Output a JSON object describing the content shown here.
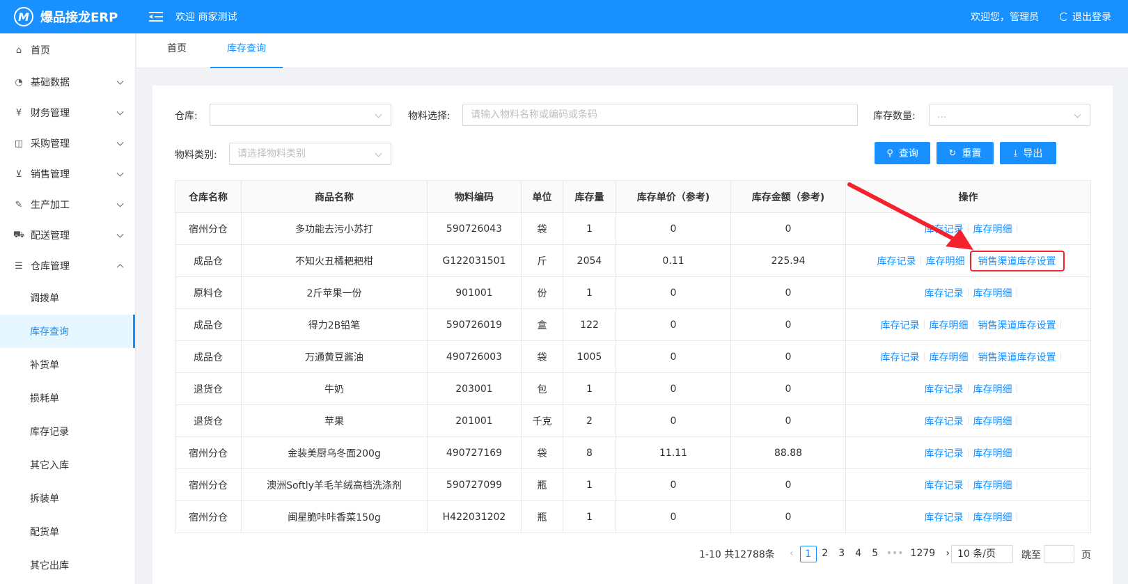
{
  "header": {
    "logo_mark": "M",
    "app_name": "爆品接龙ERP",
    "welcome": "欢迎 商家测试",
    "user": "欢迎您，管理员",
    "logout": "退出登录",
    "bg_color": "#1890ff"
  },
  "sidebar": {
    "items": [
      {
        "label": "首页",
        "icon": "home-icon"
      },
      {
        "label": "基础数据",
        "icon": "pie-chart-icon"
      },
      {
        "label": "财务管理",
        "icon": "finance-icon"
      },
      {
        "label": "采购管理",
        "icon": "bag-icon"
      },
      {
        "label": "销售管理",
        "icon": "cart-icon"
      },
      {
        "label": "生产加工",
        "icon": "wrench-icon"
      },
      {
        "label": "配送管理",
        "icon": "car-icon"
      },
      {
        "label": "仓库管理",
        "icon": "warehouse-icon"
      }
    ],
    "sub_items": [
      "调拨单",
      "库存查询",
      "补货单",
      "损耗单",
      "库存记录",
      "其它入库",
      "拆装单",
      "配货单",
      "其它出库"
    ],
    "active_sub": "库存查询"
  },
  "tabs": [
    "首页",
    "库存查询"
  ],
  "filters": {
    "warehouse_label": "仓库:",
    "material_label": "物料选择:",
    "material_placeholder": "请输入物料名称或编码或条码",
    "qty_label": "库存数量:",
    "qty_placeholder": "...",
    "category_label": "物料类别:",
    "category_placeholder": "请选择物料类别"
  },
  "buttons": {
    "query": "查询",
    "reset": "重置",
    "export": "导出"
  },
  "table": {
    "headers": [
      "仓库名称",
      "商品名称",
      "物料编码",
      "单位",
      "库存量",
      "库存单价（参考)",
      "库存金额（参考)",
      "操作"
    ],
    "rows": [
      {
        "wh": "宿州分仓",
        "name": "多功能去污小苏打",
        "code": "590726043",
        "unit": "袋",
        "qty": "1",
        "price": "0",
        "amount": "0",
        "ops": [
          "库存记录",
          "库存明细"
        ]
      },
      {
        "wh": "成品仓",
        "name": "不知火丑橘耙耙柑",
        "code": "G122031501",
        "unit": "斤",
        "qty": "2054",
        "price": "0.11",
        "amount": "225.94",
        "ops": [
          "库存记录",
          "库存明细",
          "销售渠道库存设置"
        ]
      },
      {
        "wh": "原料仓",
        "name": "2斤苹果一份",
        "code": "901001",
        "unit": "份",
        "qty": "1",
        "price": "0",
        "amount": "0",
        "ops": [
          "库存记录",
          "库存明细"
        ]
      },
      {
        "wh": "成品仓",
        "name": "得力2B铅笔",
        "code": "590726019",
        "unit": "盒",
        "qty": "122",
        "price": "0",
        "amount": "0",
        "ops": [
          "库存记录",
          "库存明细",
          "销售渠道库存设置"
        ]
      },
      {
        "wh": "成品仓",
        "name": "万通黄豆酱油",
        "code": "490726003",
        "unit": "袋",
        "qty": "1005",
        "price": "0",
        "amount": "0",
        "ops": [
          "库存记录",
          "库存明细",
          "销售渠道库存设置"
        ]
      },
      {
        "wh": "退货仓",
        "name": "牛奶",
        "code": "203001",
        "unit": "包",
        "qty": "1",
        "price": "0",
        "amount": "0",
        "ops": [
          "库存记录",
          "库存明细"
        ]
      },
      {
        "wh": "退货仓",
        "name": "苹果",
        "code": "201001",
        "unit": "千克",
        "qty": "2",
        "price": "0",
        "amount": "0",
        "ops": [
          "库存记录",
          "库存明细"
        ]
      },
      {
        "wh": "宿州分仓",
        "name": "金装美厨乌冬面200g",
        "code": "490727169",
        "unit": "袋",
        "qty": "8",
        "price": "11.11",
        "amount": "88.88",
        "ops": [
          "库存记录",
          "库存明细"
        ]
      },
      {
        "wh": "宿州分仓",
        "name": "澳洲Softly羊毛羊绒高档洗涤剂",
        "code": "590727099",
        "unit": "瓶",
        "qty": "1",
        "price": "0",
        "amount": "0",
        "ops": [
          "库存记录",
          "库存明细"
        ]
      },
      {
        "wh": "宿州分仓",
        "name": "闽星脆咔咔香菜150g",
        "code": "H422031202",
        "unit": "瓶",
        "qty": "1",
        "price": "0",
        "amount": "0",
        "ops": [
          "库存记录",
          "库存明细"
        ]
      }
    ]
  },
  "pagination": {
    "summary": "1-10 共12788条",
    "pages": [
      "1",
      "2",
      "3",
      "4",
      "5"
    ],
    "ellipsis": "•••",
    "last": "1279",
    "current": "1",
    "page_size": "10 条/页",
    "jump_label": "跳至",
    "page_suffix": "页"
  },
  "colors": {
    "accent": "#1890ff",
    "highlight": "#f5222d"
  }
}
